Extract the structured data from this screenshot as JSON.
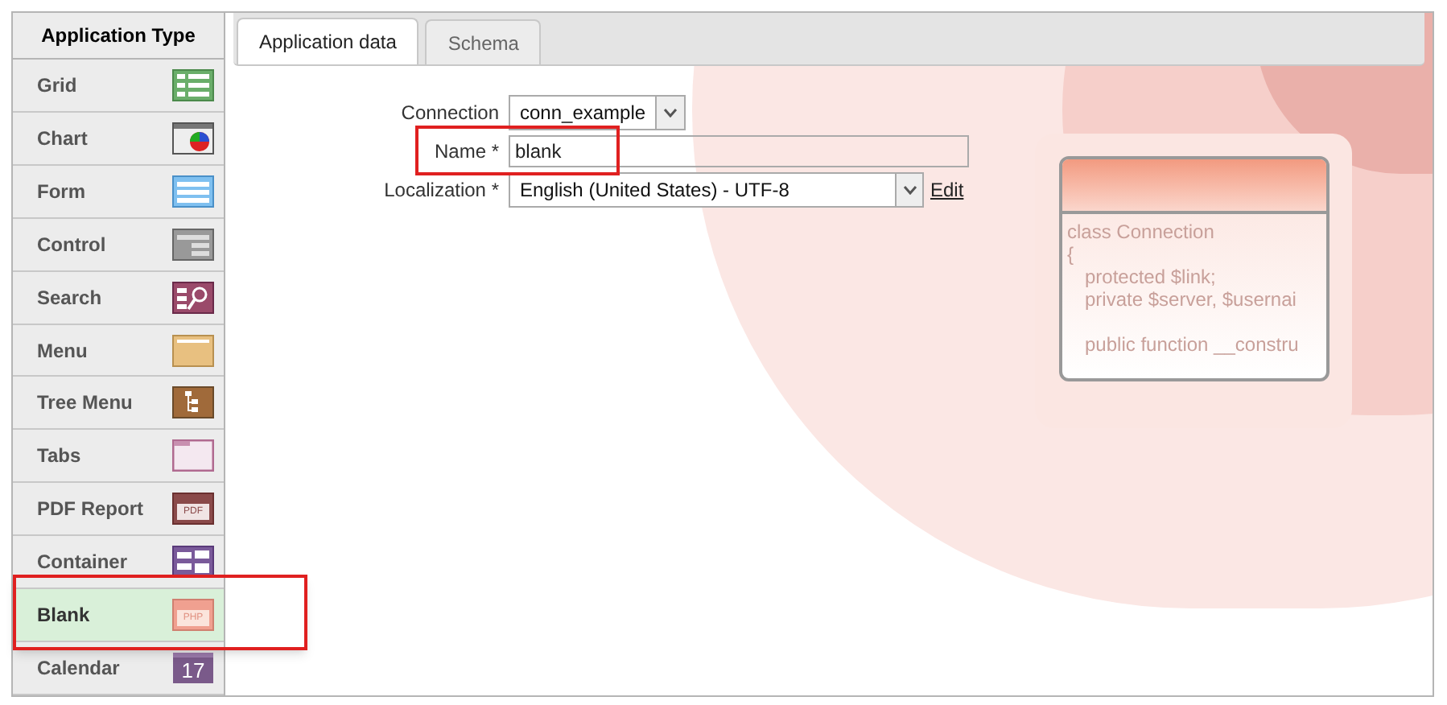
{
  "sidebar": {
    "title": "Application Type",
    "items": [
      {
        "label": "Grid",
        "selected": false,
        "highlighted": false
      },
      {
        "label": "Chart",
        "selected": false,
        "highlighted": false
      },
      {
        "label": "Form",
        "selected": false,
        "highlighted": false
      },
      {
        "label": "Control",
        "selected": false,
        "highlighted": false
      },
      {
        "label": "Search",
        "selected": false,
        "highlighted": false
      },
      {
        "label": "Menu",
        "selected": false,
        "highlighted": false
      },
      {
        "label": "Tree Menu",
        "selected": false,
        "highlighted": false
      },
      {
        "label": "Tabs",
        "selected": false,
        "highlighted": false
      },
      {
        "label": "PDF Report",
        "selected": false,
        "highlighted": false,
        "icon_text": "PDF"
      },
      {
        "label": "Container",
        "selected": false,
        "highlighted": false
      },
      {
        "label": "Blank",
        "selected": true,
        "highlighted": true,
        "icon_text": "PHP"
      },
      {
        "label": "Calendar",
        "selected": false,
        "highlighted": false,
        "icon_text": "17"
      }
    ]
  },
  "tabs": [
    {
      "label": "Application data",
      "selected": true
    },
    {
      "label": "Schema",
      "selected": false
    }
  ],
  "form": {
    "connection": {
      "label": "Connection",
      "value": "conn_example"
    },
    "name": {
      "label": "Name *",
      "value": "blank",
      "highlighted": true
    },
    "localization": {
      "label": "Localization *",
      "value": "English (United States) - UTF-8",
      "link": "Edit"
    }
  },
  "illustration": {
    "code_lines": [
      "class Connection",
      "{",
      "protected $link;",
      "private $server, $usernai",
      "public function __constru"
    ]
  }
}
